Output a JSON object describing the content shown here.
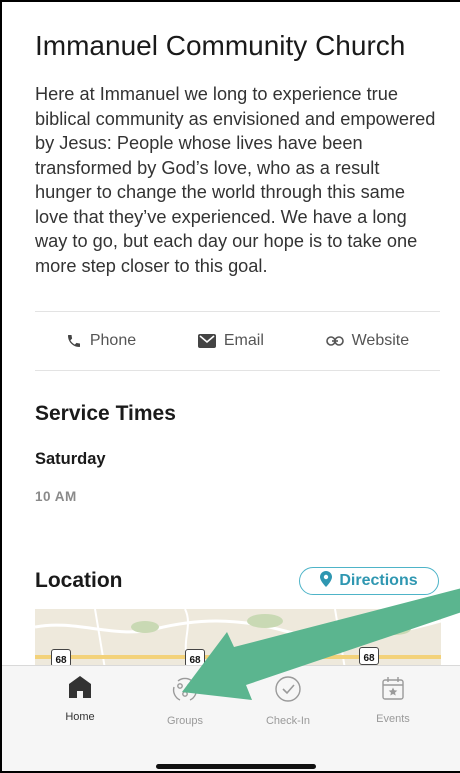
{
  "church": {
    "name": "Immanuel Community Church",
    "description": "Here at Immanuel we long to experience true biblical community as envisioned and empowered by Jesus: People whose lives have been transformed by God’s love, who as a result hunger to change the world through this same love that they’ve experienced. We have a long way to go, but each day our hope is to take one more step closer to this goal."
  },
  "contact": {
    "phone_label": "Phone",
    "email_label": "Email",
    "website_label": "Website"
  },
  "service_times": {
    "title": "Service Times",
    "day": "Saturday",
    "time": "10 AM"
  },
  "location": {
    "title": "Location",
    "directions_label": "Directions",
    "map_route_labels": [
      "68",
      "68",
      "68"
    ]
  },
  "tabbar": {
    "tabs": [
      {
        "label": "Home",
        "icon": "home-icon",
        "active": true
      },
      {
        "label": "Groups",
        "icon": "groups-icon",
        "active": false
      },
      {
        "label": "Check-In",
        "icon": "check-in-icon",
        "active": false
      },
      {
        "label": "Events",
        "icon": "events-icon",
        "active": false
      }
    ]
  },
  "colors": {
    "accent": "#2f97b1",
    "annotation_arrow": "#5bb58f",
    "tab_inactive": "#9a9a9a"
  }
}
